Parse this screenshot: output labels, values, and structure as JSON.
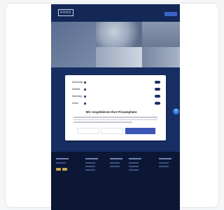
{
  "brand": {
    "logo_text": "ENSS"
  },
  "header": {
    "button_label": ""
  },
  "footer": {
    "heading": ""
  },
  "consent": {
    "rows": [
      {
        "label": "Notwendig",
        "state": ""
      },
      {
        "label": "Statistik",
        "state": ""
      },
      {
        "label": "Marketing",
        "state": ""
      },
      {
        "label": "Extern",
        "state": ""
      }
    ],
    "title": "Wir respektieren Ihre Privatsphäre",
    "buttons": {
      "necessary": "",
      "save": "",
      "accept_all": ""
    }
  },
  "colors": {
    "accent": "#3a55b5",
    "nav_bg": "#132857",
    "footer_bg": "#0b1734",
    "toggle_on": "#1c2f66",
    "chat_button": "#3d7be0"
  },
  "icons": {
    "chat": "chat-icon",
    "info": "info-icon"
  }
}
